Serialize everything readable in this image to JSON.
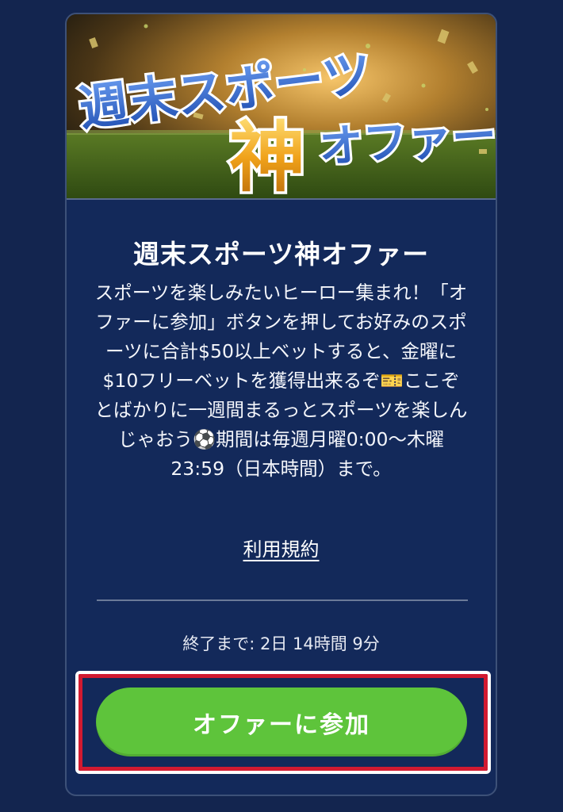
{
  "banner": {
    "line1": "週末スポーツ",
    "kami": "神",
    "line2": "オファー"
  },
  "offer": {
    "title": "週末スポーツ神オファー",
    "description": "スポーツを楽しみたいヒーロー集まれ！「オファーに参加」ボタンを押してお好みのスポーツに合計$50以上ベットすると、金曜に$10フリーベットを獲得出来るぞ🎫ここぞとばかりに一週間まるっとスポーツを楽しんじゃおう⚽期間は毎週月曜0:00〜木曜23:59（日本時間）まで。",
    "terms_label": "利用規約",
    "countdown": "終了まで: 2日 14時間 9分",
    "join_label": "オファーに参加"
  },
  "colors": {
    "background": "#13254f",
    "card": "#13295a",
    "button": "#5ec43b",
    "highlight": "#d21a30"
  }
}
